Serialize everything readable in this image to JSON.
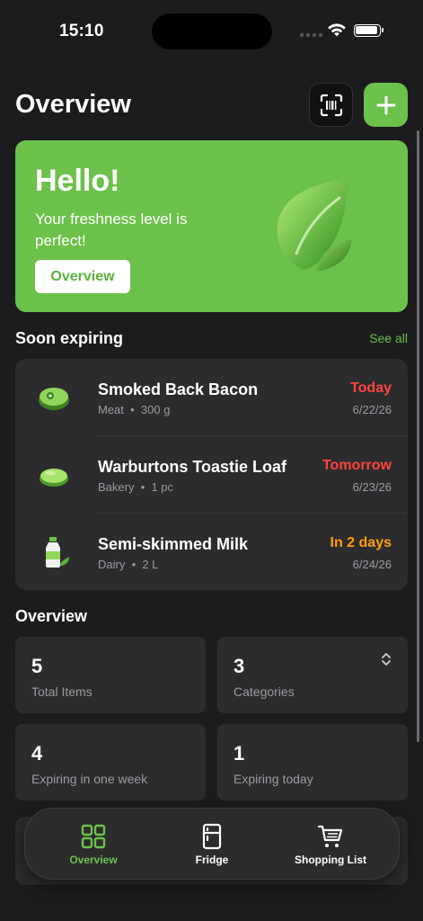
{
  "status_bar": {
    "time": "15:10"
  },
  "header": {
    "title": "Overview",
    "scan_icon": "barcode-scan-icon",
    "add_icon": "plus-icon"
  },
  "hero": {
    "title": "Hello!",
    "subtitle": "Your freshness level is perfect!",
    "button_label": "Overview",
    "icon": "leaf-icon"
  },
  "soon_expiring": {
    "title": "Soon expiring",
    "see_all": "See all",
    "items": [
      {
        "name": "Smoked Back Bacon",
        "category": "Meat",
        "quantity": "300 g",
        "due": "Today",
        "due_color": "#ff453a",
        "date": "6/22/26",
        "icon": "meat-icon"
      },
      {
        "name": "Warburtons Toastie Loaf",
        "category": "Bakery",
        "quantity": "1 pc",
        "due": "Tomorrow",
        "due_color": "#ff453a",
        "date": "6/23/26",
        "icon": "bread-icon"
      },
      {
        "name": "Semi-skimmed Milk",
        "category": "Dairy",
        "quantity": "2 L",
        "due": "In 2 days",
        "due_color": "#ff9f0a",
        "date": "6/24/26",
        "icon": "milk-icon"
      }
    ]
  },
  "overview": {
    "title": "Overview",
    "stats": [
      {
        "value": "5",
        "label": "Total Items"
      },
      {
        "value": "3",
        "label": "Categories",
        "icon": "chevron-up-down-icon"
      },
      {
        "value": "4",
        "label": "Expiring in one week"
      },
      {
        "value": "1",
        "label": "Expiring today"
      }
    ]
  },
  "tabs": [
    {
      "label": "Overview",
      "icon": "grid-icon",
      "active": true
    },
    {
      "label": "Fridge",
      "icon": "fridge-icon",
      "active": false
    },
    {
      "label": "Shopping List",
      "icon": "cart-icon",
      "active": false
    }
  ],
  "colors": {
    "accent": "#6cc14a",
    "background": "#1c1c1e",
    "card": "#2c2c2e",
    "danger": "#ff453a",
    "warning": "#ff9f0a"
  }
}
